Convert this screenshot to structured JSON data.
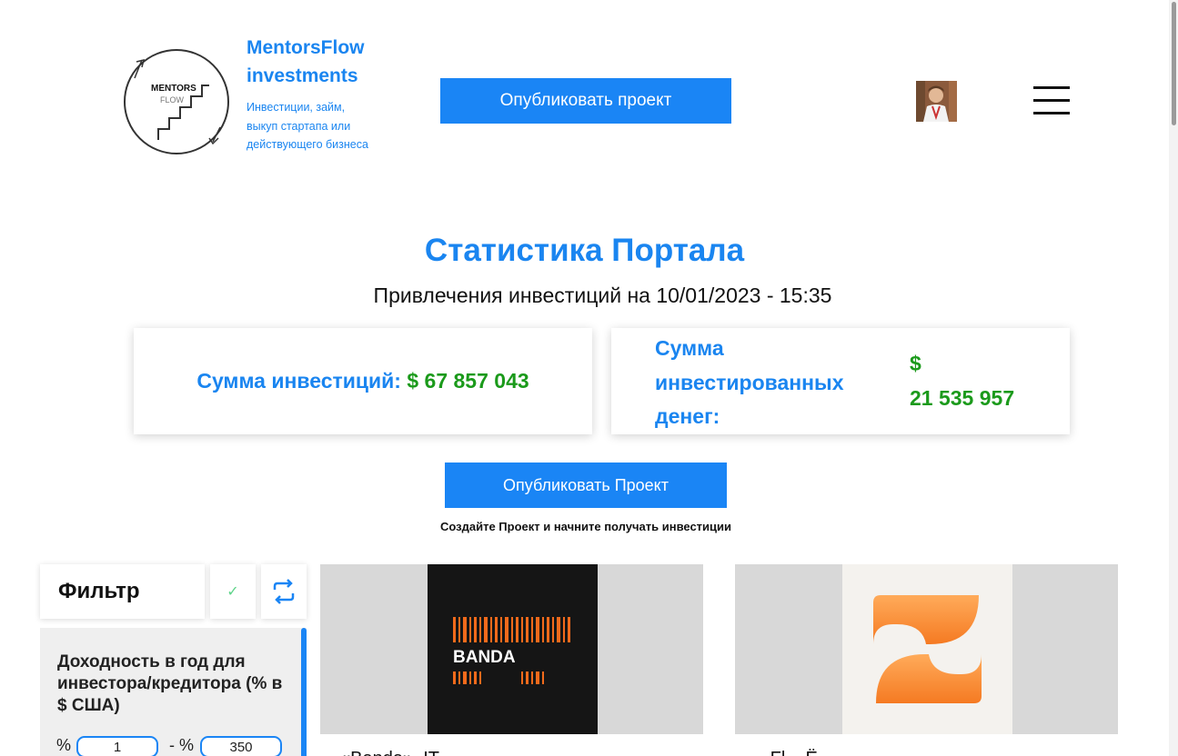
{
  "header": {
    "brand_title_line1": "MentorsFlow",
    "brand_title_line2": "investments",
    "brand_subtitle": "Инвестиции, займ, выкуп стартапа или действующего бизнеса",
    "logo_text_top": "MENTORS",
    "logo_text_bottom": "FLOW",
    "publish_button": "Опубликовать проект"
  },
  "stats": {
    "title": "Статистика Портала",
    "subtitle": "Привлечения инвестиций на 10/01/2023 - 15:35",
    "invest_sum_label": "Сумма инвестиций:",
    "invest_sum_value": "$ 67 857 043",
    "invested_money_label": "Сумма инвестированных денег:",
    "invested_money_currency": "$",
    "invested_money_value": "21 535 957"
  },
  "cta": {
    "button": "Опубликовать Проект",
    "caption": "Создайте Проект и начните получать инвестиции"
  },
  "filter": {
    "title": "Фильтр",
    "apply_icon": "check-icon",
    "reset_icon": "refresh-icon",
    "section_title": "Доходность в год для инвестора/кредитора (% в $ США)",
    "percent_sign": "%",
    "range_separator": "- %",
    "min_value": "1",
    "max_value": "350"
  },
  "projects": [
    {
      "logo_text": "BANDA",
      "title": "«Banda», IT..."
    },
    {
      "logo_icon": "orange-s-logo",
      "title": "...Fl... Ё..."
    }
  ],
  "colors": {
    "accent": "#1a85f5",
    "green": "#1b9a1b"
  }
}
